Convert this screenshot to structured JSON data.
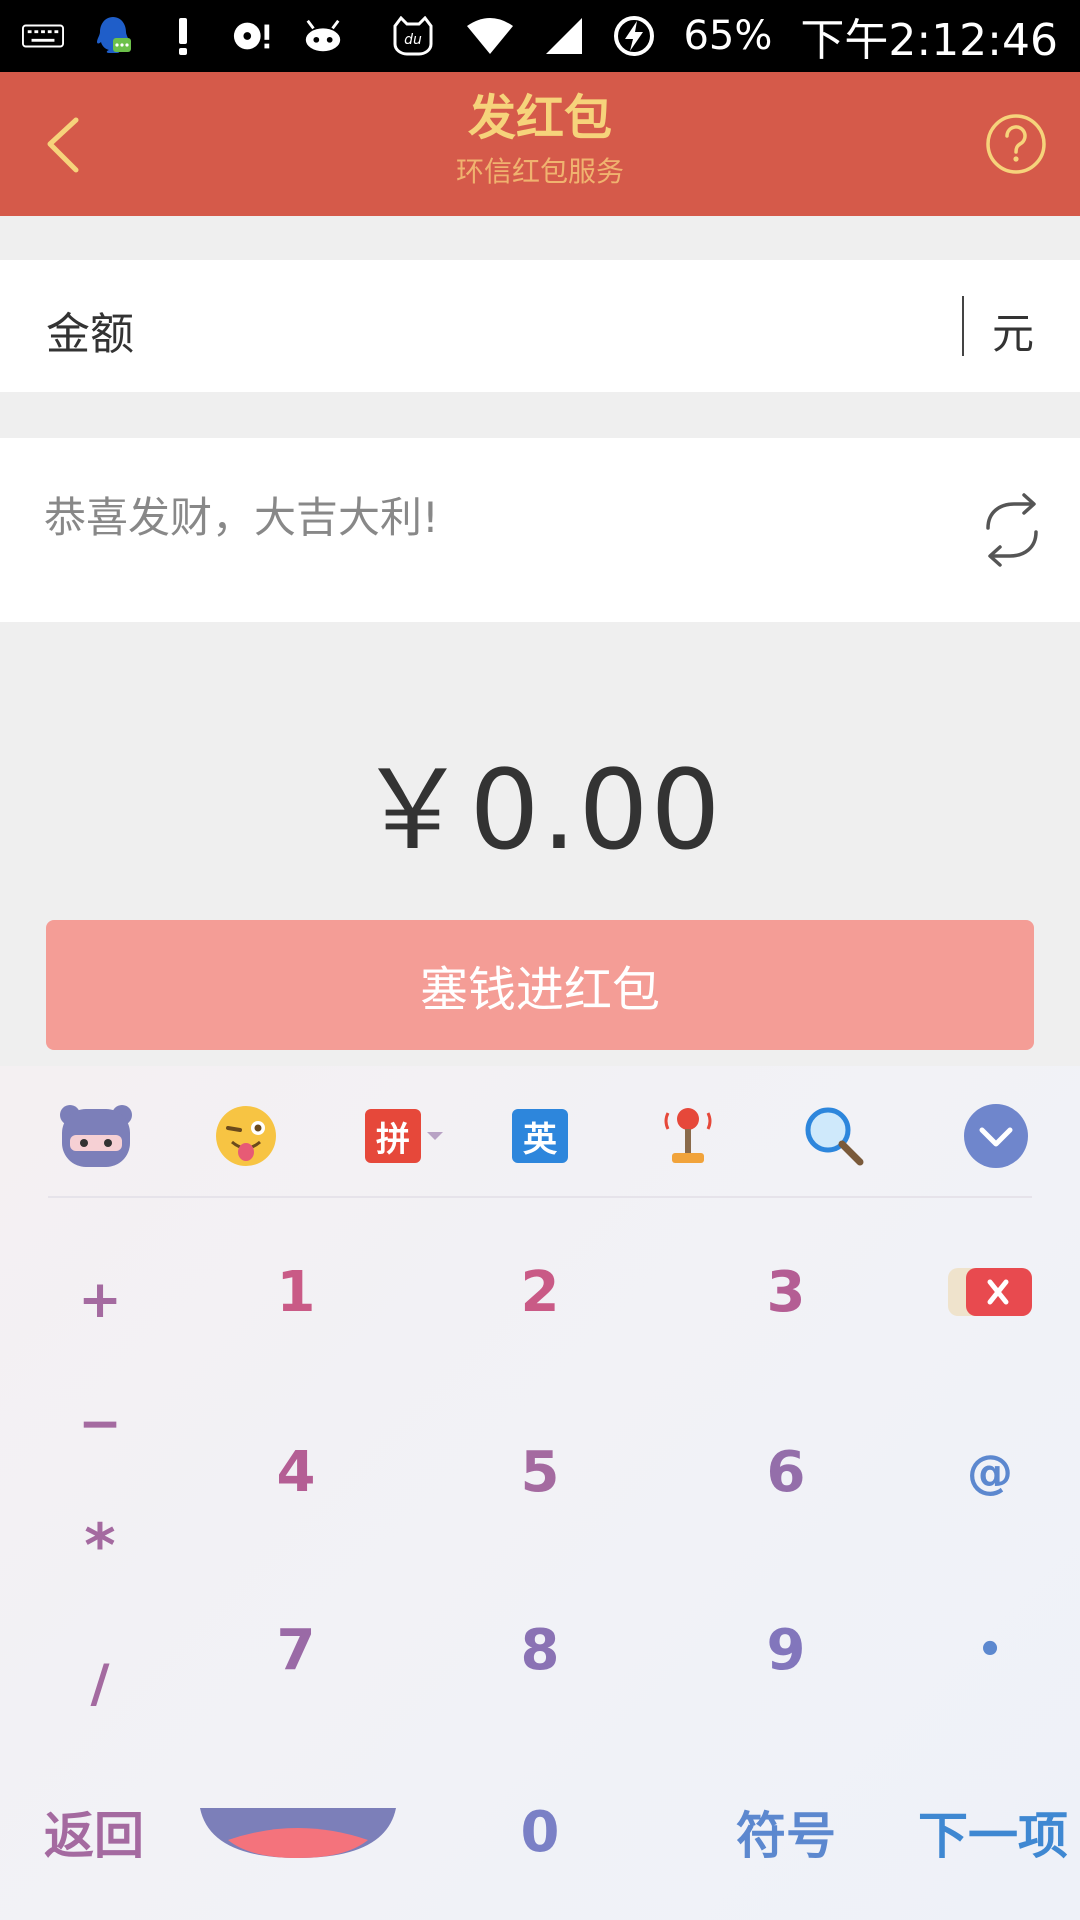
{
  "status_bar": {
    "battery_percent": "65%",
    "time": "下午2:12:46",
    "du_label": "du"
  },
  "app_bar": {
    "title": "发红包",
    "subtitle": "环信红包服务"
  },
  "amount_field": {
    "label": "金额",
    "value": "",
    "unit": "元"
  },
  "greeting": {
    "text": "恭喜发财，大吉大利!"
  },
  "total": {
    "display": "￥0.00"
  },
  "submit": {
    "label": "塞钱进红包"
  },
  "keyboard": {
    "toolbar": {
      "pinyin_label": "拼",
      "english_label": "英"
    },
    "side_symbols": [
      "+",
      "−",
      "*",
      "/"
    ],
    "digits": [
      "1",
      "2",
      "3",
      "4",
      "5",
      "6",
      "7",
      "8",
      "9",
      "0"
    ],
    "right_keys": {
      "at": "@",
      "dot": "•"
    },
    "bottom": {
      "back_label": "返回",
      "symbols_label": "符号",
      "next_label": "下一项"
    }
  },
  "colors": {
    "app_bar": "#d55a4a",
    "title": "#f6d37b",
    "submit": "#f49d96",
    "key_pink": "#c95a86",
    "key_purple": "#a46aa0",
    "key_blue": "#5c88cf"
  }
}
